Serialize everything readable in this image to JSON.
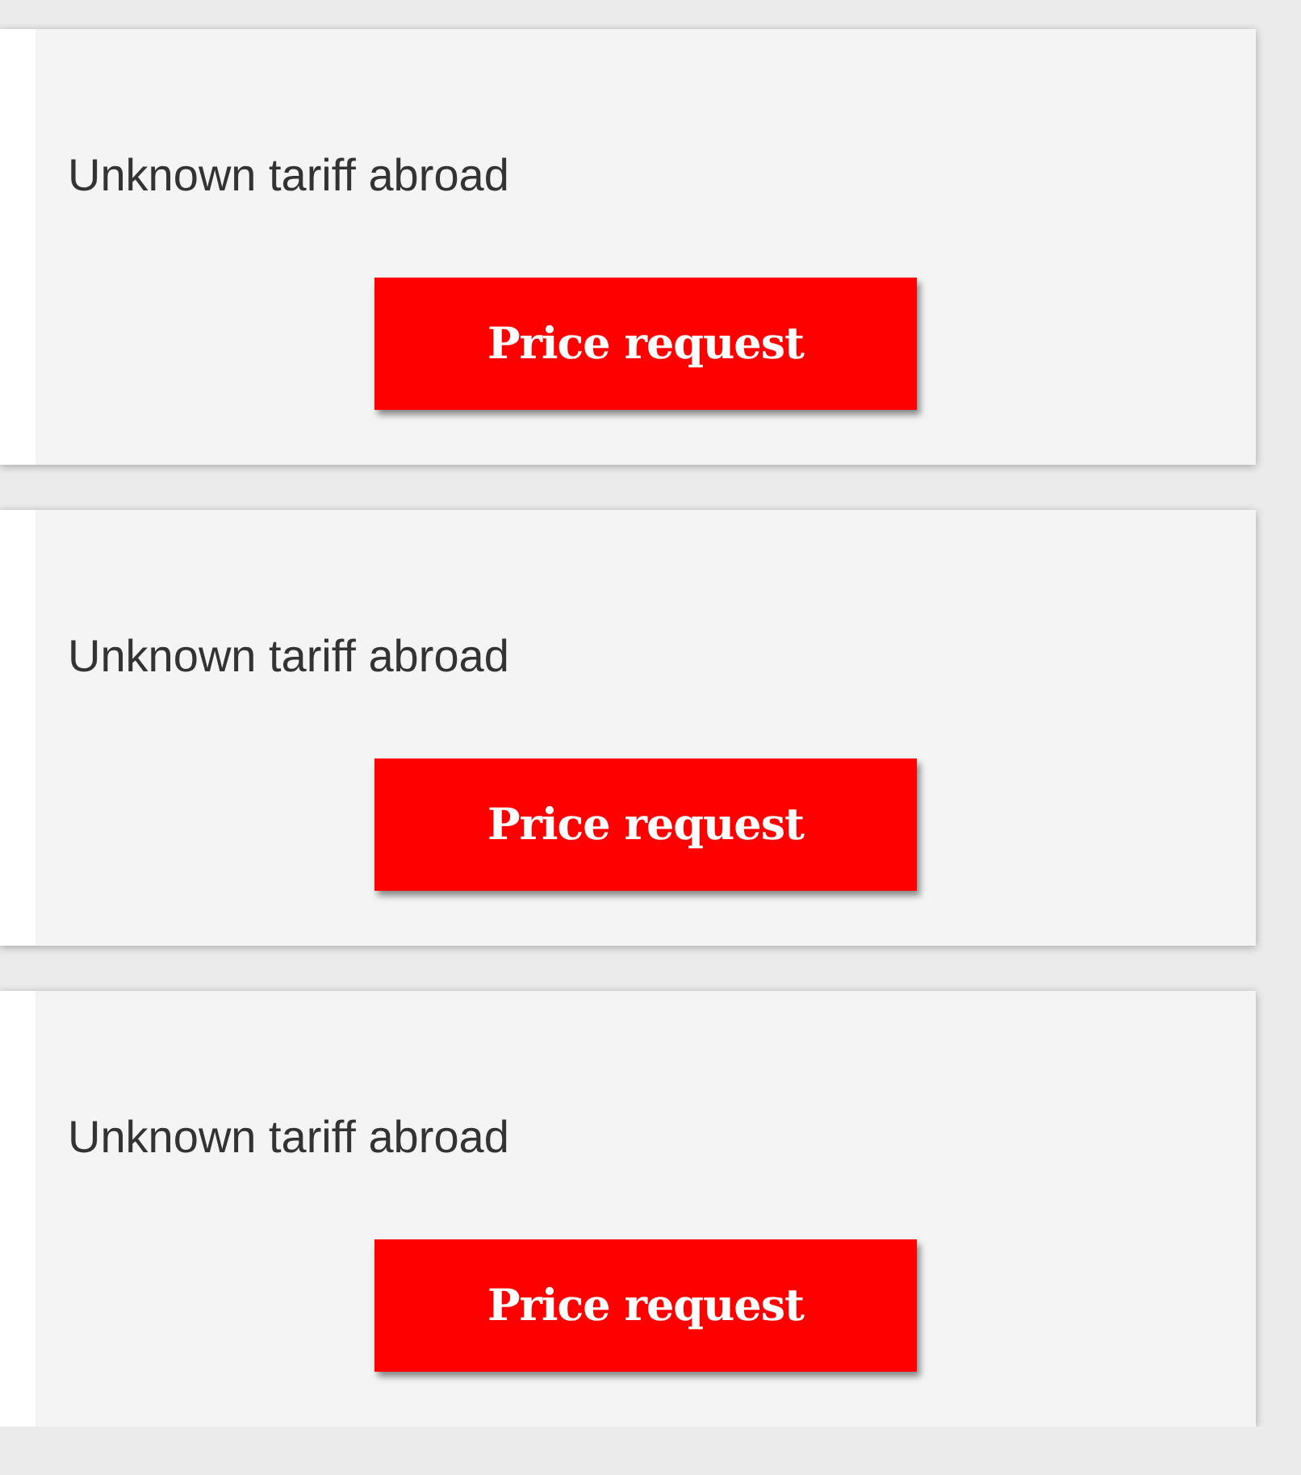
{
  "offers": [
    {
      "tariff": "Unknown tariff abroad",
      "button": "Price request"
    },
    {
      "tariff": "Unknown tariff abroad",
      "button": "Price request"
    },
    {
      "tariff": "Unknown tariff abroad",
      "button": "Price request"
    }
  ]
}
